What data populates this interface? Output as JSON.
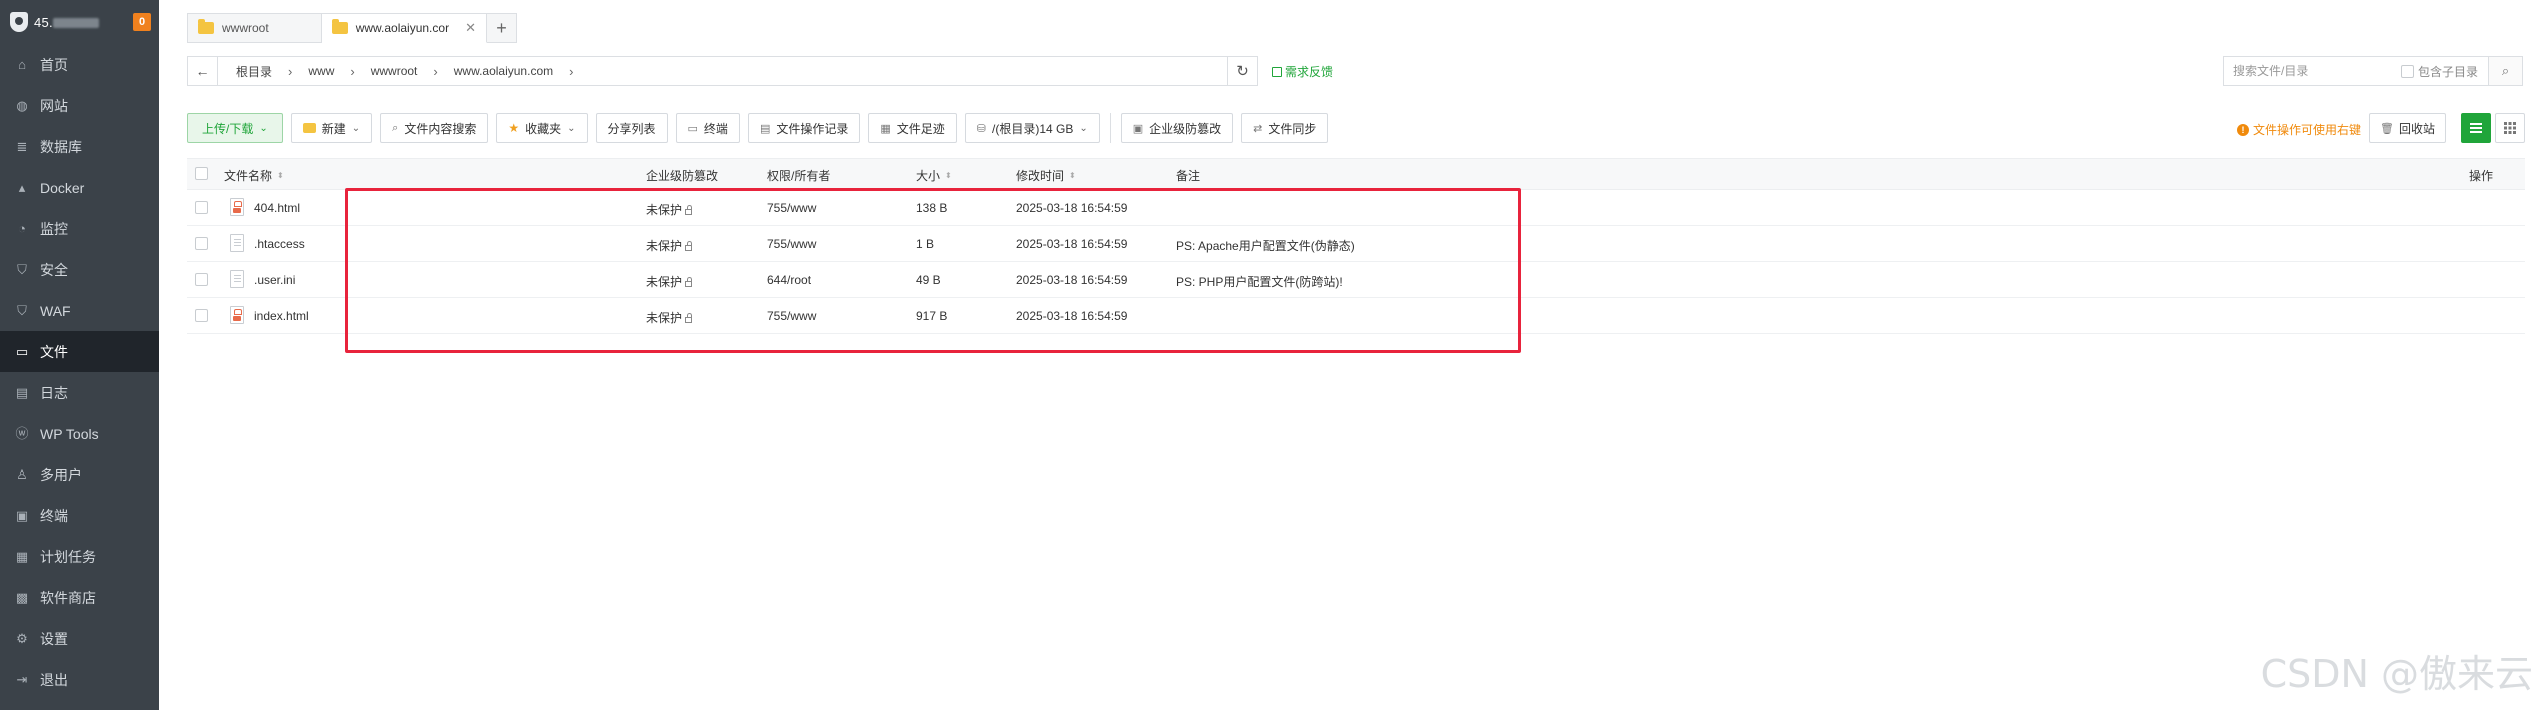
{
  "sidebar": {
    "server_ip_prefix": "45.",
    "badge": "0",
    "items": [
      {
        "label": "首页",
        "icon": "home-icon"
      },
      {
        "label": "网站",
        "icon": "globe-icon"
      },
      {
        "label": "数据库",
        "icon": "database-icon"
      },
      {
        "label": "Docker",
        "icon": "docker-icon"
      },
      {
        "label": "监控",
        "icon": "monitor-icon"
      },
      {
        "label": "安全",
        "icon": "shield-icon"
      },
      {
        "label": "WAF",
        "icon": "waf-shield-icon"
      },
      {
        "label": "文件",
        "icon": "folder-icon",
        "active": true
      },
      {
        "label": "日志",
        "icon": "log-icon"
      },
      {
        "label": "WP Tools",
        "icon": "wordpress-icon"
      },
      {
        "label": "多用户",
        "icon": "users-icon"
      },
      {
        "label": "终端",
        "icon": "terminal-icon"
      },
      {
        "label": "计划任务",
        "icon": "calendar-icon"
      },
      {
        "label": "软件商店",
        "icon": "store-icon"
      },
      {
        "label": "设置",
        "icon": "gear-icon"
      },
      {
        "label": "退出",
        "icon": "logout-icon"
      }
    ]
  },
  "tabs": [
    {
      "label": "wwwroot",
      "active": false
    },
    {
      "label": "www.aolaiyun.cor",
      "active": true
    }
  ],
  "address": {
    "crumbs": [
      "根目录",
      "www",
      "wwwroot",
      "www.aolaiyun.com"
    ],
    "feedback": "需求反馈"
  },
  "search": {
    "placeholder": "搜索文件/目录",
    "include_sub_label": "包含子目录"
  },
  "toolbar": {
    "upload": "上传/下载",
    "new": "新建",
    "content_search": "文件内容搜索",
    "favorites": "收藏夹",
    "share_list": "分享列表",
    "terminal": "终端",
    "op_log": "文件操作记录",
    "footprint": "文件足迹",
    "disk": "/(根目录)14 GB",
    "enterprise_tamper": "企业级防篡改",
    "sync": "文件同步",
    "tip": "文件操作可使用右键",
    "recycle": "回收站"
  },
  "table": {
    "headers": {
      "name": "文件名称",
      "tamper": "企业级防篡改",
      "perm": "权限/所有者",
      "size": "大小",
      "mtime": "修改时间",
      "note": "备注",
      "action": "操作"
    },
    "rows": [
      {
        "name": "404.html",
        "type": "html",
        "tamper": "未保护",
        "perm": "755/www",
        "size": "138 B",
        "mtime": "2025-03-18 16:54:59",
        "note": ""
      },
      {
        "name": ".htaccess",
        "type": "plain",
        "tamper": "未保护",
        "perm": "755/www",
        "size": "1 B",
        "mtime": "2025-03-18 16:54:59",
        "note": "PS: Apache用户配置文件(伪静态)"
      },
      {
        "name": ".user.ini",
        "type": "plain",
        "tamper": "未保护",
        "perm": "644/root",
        "size": "49 B",
        "mtime": "2025-03-18 16:54:59",
        "note": "PS: PHP用户配置文件(防跨站)!"
      },
      {
        "name": "index.html",
        "type": "html",
        "tamper": "未保护",
        "perm": "755/www",
        "size": "917 B",
        "mtime": "2025-03-18 16:54:59",
        "note": ""
      }
    ]
  },
  "watermark": "CSDN @傲来云",
  "colors": {
    "accent": "#20a53a",
    "sidebar": "#3b4249",
    "highlight": "#e8233c",
    "warning": "#f08a0c"
  }
}
